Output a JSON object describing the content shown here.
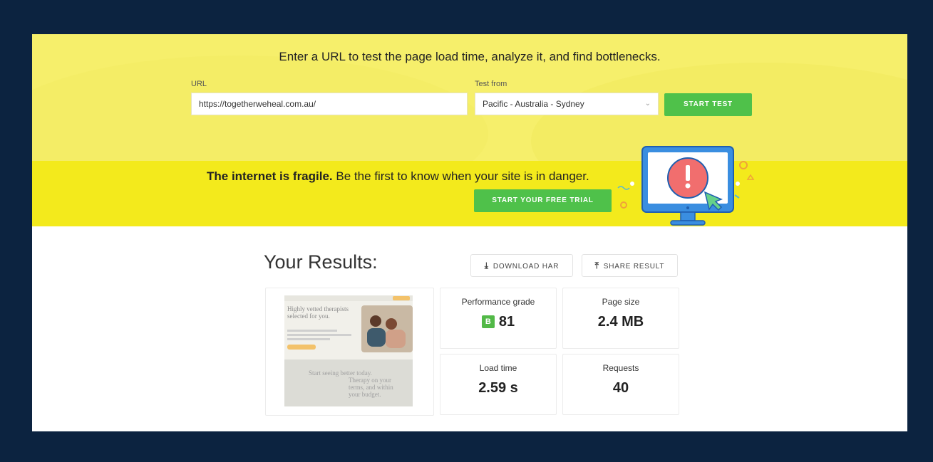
{
  "hero": {
    "title": "Enter a URL to test the page load time, analyze it, and find bottlenecks.",
    "url_label": "URL",
    "url_value": "https://togetherweheal.com.au/",
    "test_from_label": "Test from",
    "test_from_value": "Pacific - Australia - Sydney",
    "start_test_label": "START TEST"
  },
  "banner": {
    "bold_text": "The internet is fragile.",
    "rest_text": " Be the first to know when your site is in danger.",
    "trial_label": "START YOUR FREE TRIAL"
  },
  "results": {
    "title": "Your Results:",
    "download_har_label": "DOWNLOAD HAR",
    "share_label": "SHARE RESULT",
    "screenshot": {
      "headline": "Highly vetted therapists selected for you.",
      "subhead1": "Start seeing better today.",
      "subhead2": "Therapy on your terms, and within your budget."
    },
    "metrics": {
      "performance": {
        "label": "Performance grade",
        "grade": "B",
        "value": "81"
      },
      "page_size": {
        "label": "Page size",
        "value": "2.4 MB"
      },
      "load_time": {
        "label": "Load time",
        "value": "2.59 s"
      },
      "requests": {
        "label": "Requests",
        "value": "40"
      }
    }
  },
  "colors": {
    "background": "#0c2340",
    "hero": "#f6ef6b",
    "banner": "#f3ea1c",
    "accent_green": "#4fc14a",
    "grade_green": "#52b947"
  },
  "icons": {
    "download": "download-icon",
    "share": "share-icon",
    "chevron": "chevron-down-icon",
    "alert": "alert-monitor-icon"
  }
}
